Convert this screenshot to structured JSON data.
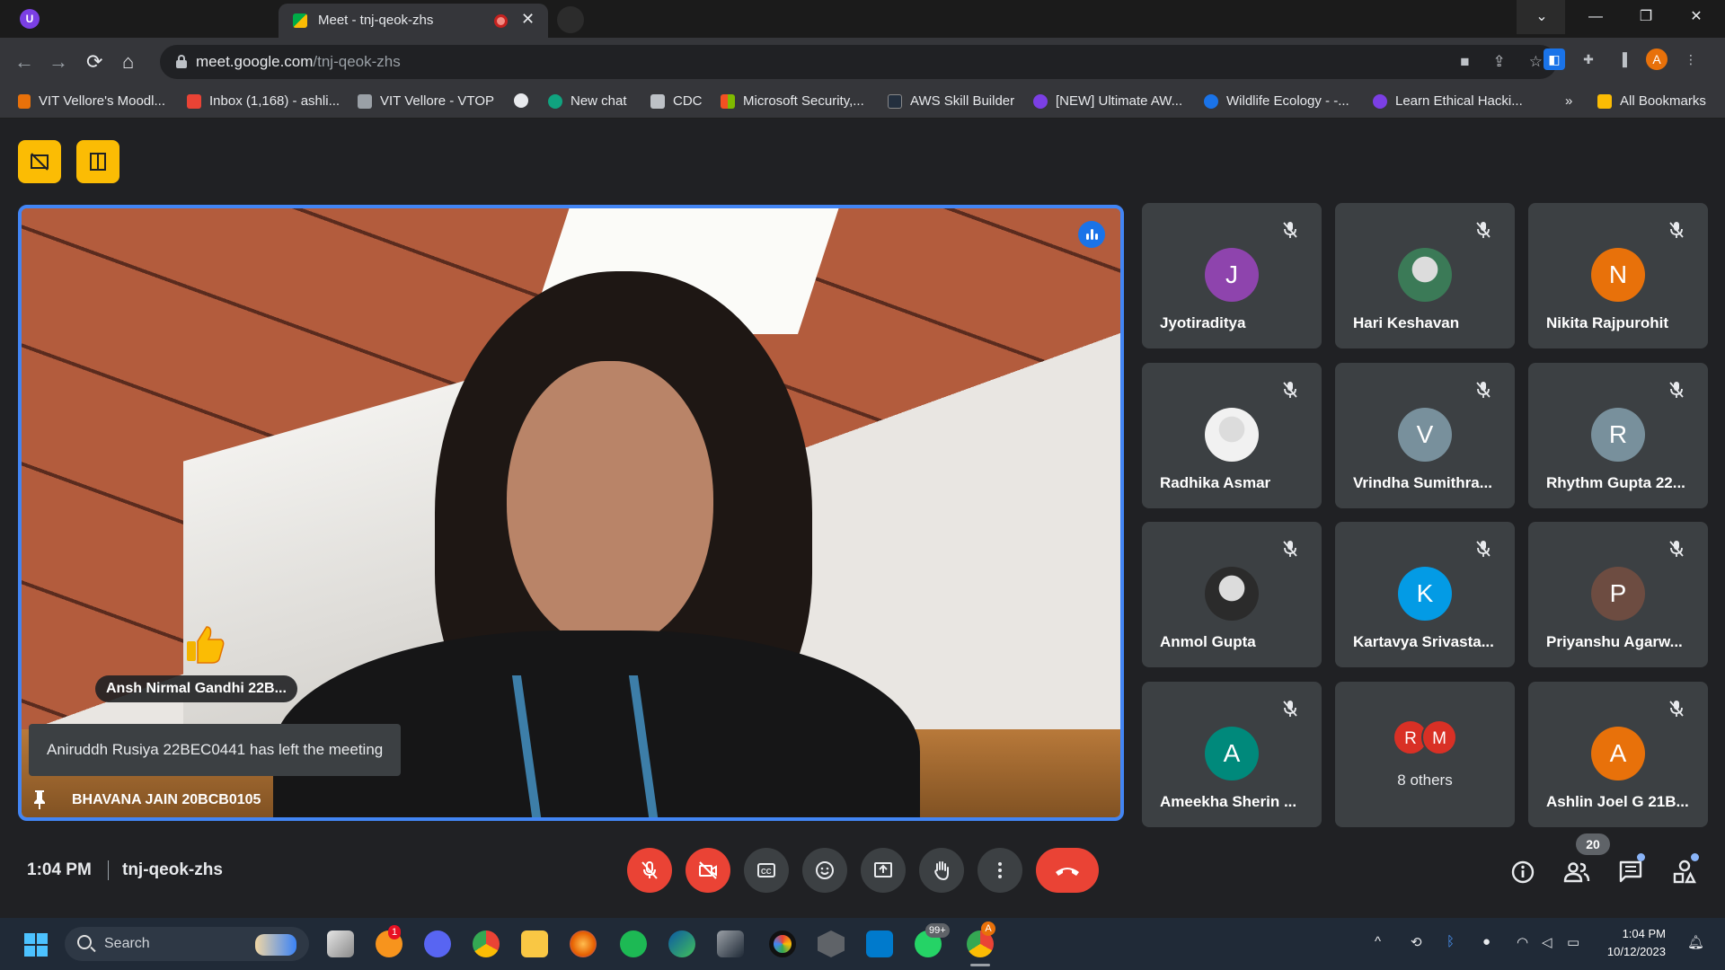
{
  "browser": {
    "tab_title": "Meet - tnj-qeok-zhs",
    "tab_close": "✕",
    "url_host": "meet.google.com",
    "url_path": "/tnj-qeok-zhs",
    "profile_initial": "A",
    "tab_profile_letter": "U",
    "window_controls": {
      "tabsearch": "⌄",
      "minimize": "—",
      "restore": "❐",
      "close": "✕"
    },
    "nav": {
      "back": "←",
      "forward": "→",
      "reload": "⟳",
      "home": "⌂"
    }
  },
  "bookmarks": {
    "items": [
      {
        "label": "VIT Vellore's Moodl...",
        "color": "#e8710a"
      },
      {
        "label": "Inbox (1,168) - ashli...",
        "color": "#ea4335"
      },
      {
        "label": "VIT Vellore - VTOP",
        "color": "#9aa0a6"
      },
      {
        "label": "",
        "color": "#e8eaed"
      },
      {
        "label": "New chat",
        "color": "#10a37f"
      },
      {
        "label": "CDC",
        "color": "#bdc1c6"
      },
      {
        "label": "Microsoft Security,...",
        "color": "#f25022"
      },
      {
        "label": "AWS Skill Builder",
        "color": "#232f3e"
      },
      {
        "label": "[NEW] Ultimate AW...",
        "color": "#7b3fe4"
      },
      {
        "label": "Wildlife Ecology - -...",
        "color": "#1a73e8"
      },
      {
        "label": "Learn Ethical Hacki...",
        "color": "#7b3fe4"
      }
    ],
    "more": "»",
    "all_bookmarks": "All Bookmarks"
  },
  "stage": {
    "presenter_name": "BHAVANA JAIN 20BCB0105",
    "reaction_name": "Ansh Nirmal Gandhi 22B...",
    "toast": "Aniruddh Rusiya 22BEC0441 has left the meeting"
  },
  "participants": [
    {
      "name": "Jyotiraditya",
      "initial": "J",
      "color": "#8e44ad",
      "kind": "letter"
    },
    {
      "name": "Hari Keshavan",
      "initial": "",
      "color": "#3b7a57",
      "kind": "photo"
    },
    {
      "name": "Nikita Rajpurohit",
      "initial": "N",
      "color": "#e8710a",
      "kind": "letter"
    },
    {
      "name": "Radhika Asmar",
      "initial": "",
      "color": "#f1f1f1",
      "kind": "photo"
    },
    {
      "name": "Vrindha Sumithra...",
      "initial": "V",
      "color": "#78909c",
      "kind": "letter"
    },
    {
      "name": "Rhythm Gupta 22...",
      "initial": "R",
      "color": "#78909c",
      "kind": "letter"
    },
    {
      "name": "Anmol Gupta",
      "initial": "",
      "color": "#2b2b2b",
      "kind": "photo"
    },
    {
      "name": "Kartavya Srivasta...",
      "initial": "K",
      "color": "#039be5",
      "kind": "letter"
    },
    {
      "name": "Priyanshu Agarw...",
      "initial": "P",
      "color": "#6d4c41",
      "kind": "letter"
    },
    {
      "name": "Ameekha Sherin ...",
      "initial": "A",
      "color": "#00897b",
      "kind": "letter"
    },
    {
      "name": "",
      "initial": "",
      "color": "",
      "kind": "others"
    },
    {
      "name": "Ashlin Joel G 21B...",
      "initial": "A",
      "color": "#e8710a",
      "kind": "letter"
    }
  ],
  "others_tile": {
    "label": "8 others",
    "avatars": [
      "R",
      "M"
    ]
  },
  "meeting": {
    "time": "1:04 PM",
    "code": "tnj-qeok-zhs",
    "participant_count": "20"
  },
  "taskbar": {
    "search_placeholder": "Search",
    "badge_mail": "1",
    "badge_whatsapp": "99+",
    "badge_chrome": "A",
    "time": "1:04 PM",
    "date": "10/12/2023",
    "tray_chevron": "^"
  }
}
